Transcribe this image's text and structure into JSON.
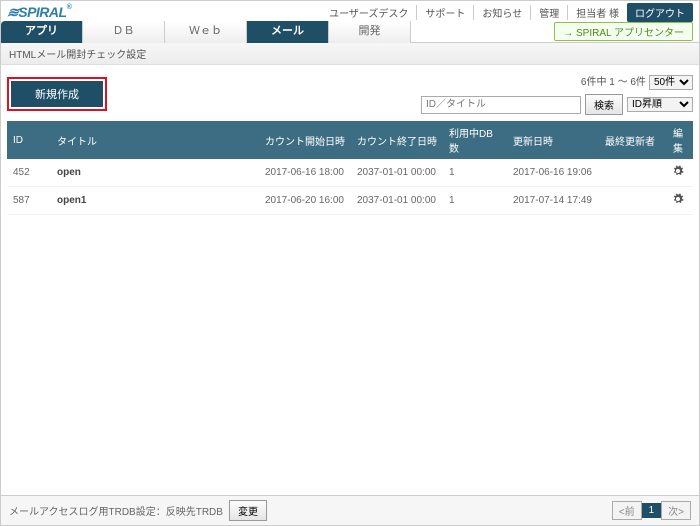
{
  "brand": {
    "name": "SPIRAL"
  },
  "topnav": {
    "userdesk": "ユーザーズデスク",
    "support": "サポート",
    "news": "お知らせ",
    "admin": "管理",
    "rep": "担当者 様",
    "logout": "ログアウト"
  },
  "tabs": {
    "app": "アプリ",
    "db": "ＤＢ",
    "web": "Ｗｅｂ",
    "mail": "メール",
    "dev": "開発",
    "appcenter": "SPIRAL アプリセンター"
  },
  "subhead": "HTMLメール開封チェック設定",
  "buttons": {
    "new": "新規作成",
    "search": "検索",
    "change": "変更"
  },
  "search": {
    "placeholder": "ID／タイトル"
  },
  "sort": {
    "selected": "ID昇順"
  },
  "pager": {
    "summary": "6件中 1 ～ 6件",
    "pagesize": "50件",
    "prev": "<前",
    "page": "1",
    "next": "次>"
  },
  "columns": {
    "id": "ID",
    "title": "タイトル",
    "count_start": "カウント開始日時",
    "count_end": "カウント終了日時",
    "db_used": "利用中DB数",
    "updated": "更新日時",
    "updated_by": "最終更新者",
    "edit": "編集"
  },
  "rows": [
    {
      "id": "452",
      "title": "open",
      "count_start": "2017-06-16 18:00",
      "count_end": "2037-01-01 00:00",
      "db_used": "1",
      "updated": "2017-06-16 19:06",
      "updated_by": ""
    },
    {
      "id": "587",
      "title": "open1",
      "count_start": "2017-06-20 16:00",
      "count_end": "2037-01-01 00:00",
      "db_used": "1",
      "updated": "2017-07-14 17:49",
      "updated_by": ""
    }
  ],
  "footer": {
    "label": "メールアクセスログ用TRDB設定：反映先TRDB"
  }
}
